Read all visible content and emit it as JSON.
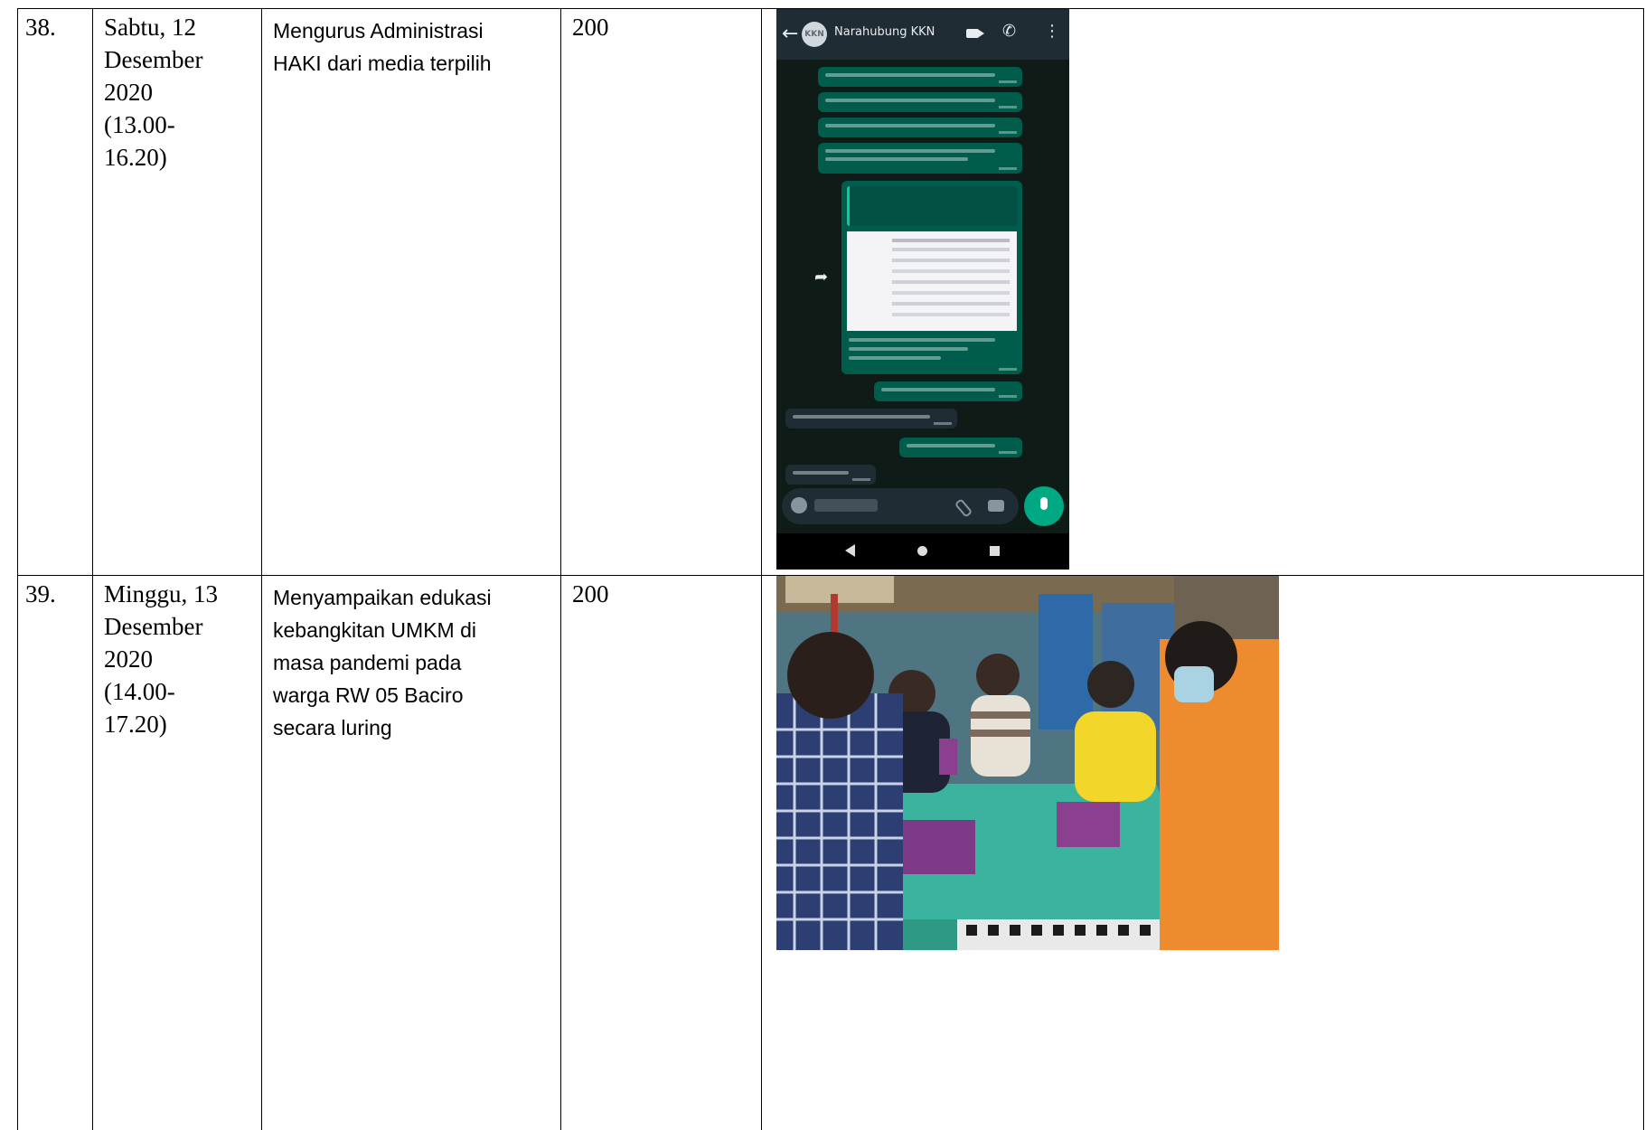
{
  "rows": [
    {
      "no": "38.",
      "date_lines": [
        "Sabtu, 12",
        "Desember",
        "2020",
        "(13.00-",
        "16.20)"
      ],
      "activity_lines": [
        "Mengurus Administrasi",
        "HAKI dari media terpilih"
      ],
      "minutes": "200",
      "proof": {
        "type": "chat-screenshot",
        "contact_name": "Narahubung KKN",
        "avatar_text": "KKN",
        "icons": [
          "back-arrow-icon",
          "video-call-icon",
          "phone-call-icon",
          "menu-icon",
          "share-icon",
          "emoji-icon",
          "attach-icon",
          "camera-icon",
          "mic-icon",
          "nav-back-icon",
          "nav-home-icon",
          "nav-recent-icon"
        ]
      }
    },
    {
      "no": "39.",
      "date_lines": [
        "Minggu, 13",
        "Desember",
        "2020",
        "(14.00-",
        "17.20)"
      ],
      "activity_lines": [
        "Menyampaikan edukasi",
        "kebangkitan UMKM di",
        "masa pandemi pada",
        "warga RW 05 Baciro",
        "secara luring"
      ],
      "minutes": "200",
      "proof": {
        "type": "photo"
      }
    }
  ],
  "colors": {
    "chat_bg": "#0e1b16",
    "chat_header": "#1f2c33",
    "bubble_out": "#005c4b",
    "mic_button": "#00a884"
  }
}
